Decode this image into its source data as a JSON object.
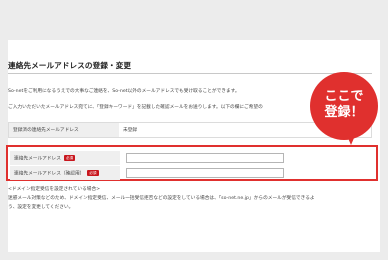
{
  "page": {
    "title": "連絡先メールアドレスの登録・変更",
    "lead_line1": "So-netをご利用になるうえでの大事なご連絡を、So-net以外のメールアドレスでも受け取ることができます。",
    "lead_line2": "ご入力いただいたメールアドレス宛てに、「登録キーワード」を記載した確認メールをお送りします。以下の欄にご希望の"
  },
  "registered": {
    "label": "登録済の連絡先メールアドレス",
    "value": "未登録"
  },
  "form": {
    "email_label": "連絡先メールアドレス",
    "email_confirm_label": "連絡先メールアドレス（確認用）",
    "required_badge": "必須",
    "email_value": "",
    "email_confirm_value": ""
  },
  "notes": {
    "title": "<ドメイン指定受信を設定されている場合>",
    "line1": "迷惑メール対策などのため、ドメイン指定受信、メール一括受信拒否などの設定をしている場合は、「so-net.ne.jp」からのメールが受信できるよ",
    "line2": "う、設定を変更してください。"
  },
  "callout": {
    "line1": "ここで",
    "line2": "登録！"
  },
  "colors": {
    "highlight": "#e0302e",
    "required_badge": "#c8161d",
    "background": "#ececec"
  }
}
